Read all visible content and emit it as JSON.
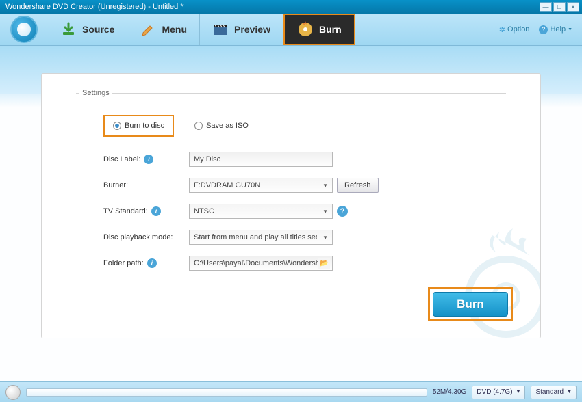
{
  "window": {
    "title": "Wondershare DVD Creator (Unregistered) - Untitled *"
  },
  "tabs": {
    "source": "Source",
    "menu": "Menu",
    "preview": "Preview",
    "burn": "Burn"
  },
  "toolbar_right": {
    "option": "Option",
    "help": "Help"
  },
  "settings": {
    "legend": "Settings",
    "radio": {
      "burn_to_disc": "Burn to disc",
      "save_as_iso": "Save as ISO"
    },
    "disc_label": {
      "label": "Disc Label:",
      "value": "My Disc"
    },
    "burner": {
      "label": "Burner:",
      "value": "F:DVDRAM GU70N",
      "refresh": "Refresh"
    },
    "tv_standard": {
      "label": "TV Standard:",
      "value": "NTSC"
    },
    "playback_mode": {
      "label": "Disc playback mode:",
      "value": "Start from menu and play all titles sequentially"
    },
    "folder_path": {
      "label": "Folder path:",
      "value": "C:\\Users\\payal\\Documents\\Wondershare DVD"
    }
  },
  "burn_button": "Burn",
  "status": {
    "size": "52M/4.30G",
    "disc_type": "DVD (4.7G)",
    "quality": "Standard"
  }
}
